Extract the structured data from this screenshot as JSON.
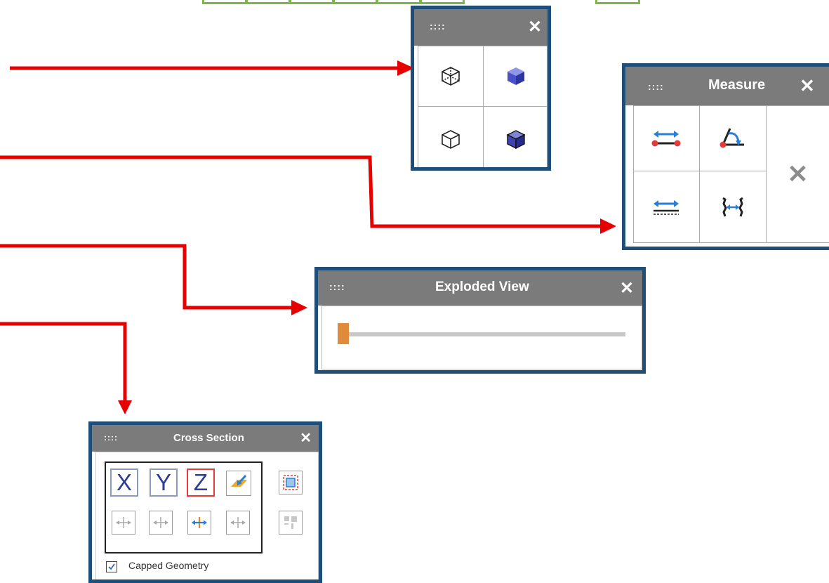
{
  "display_panel": {
    "grip": "::::",
    "close_glyph": "✕",
    "buttons": [
      "wireframe-cube-icon",
      "shaded-cube-icon",
      "hidden-line-cube-icon",
      "shaded-edges-cube-icon"
    ]
  },
  "measure_panel": {
    "grip": "::::",
    "title": "Measure",
    "close_glyph": "✕",
    "clear_glyph": "✕",
    "buttons": [
      "point-distance-icon",
      "angle-icon",
      "edge-distance-icon",
      "face-distance-icon",
      "clear-measurements-icon"
    ]
  },
  "exploded_panel": {
    "grip": "::::",
    "title": "Exploded View",
    "close_glyph": "✕",
    "slider_value": 0,
    "accent_color": "#e08a3c"
  },
  "cross_panel": {
    "grip": "::::",
    "title": "Cross Section",
    "close_glyph": "✕",
    "axes": [
      "X",
      "Y",
      "Z"
    ],
    "active_axis": "Z",
    "checkbox_label": "Capped Geometry",
    "checkbox_checked": true
  },
  "colors": {
    "arrow": "#e60000",
    "panel_border": "#1f4e79",
    "titlebar": "#7b7b7b",
    "toolbar_tile_border": "#7ab648"
  }
}
